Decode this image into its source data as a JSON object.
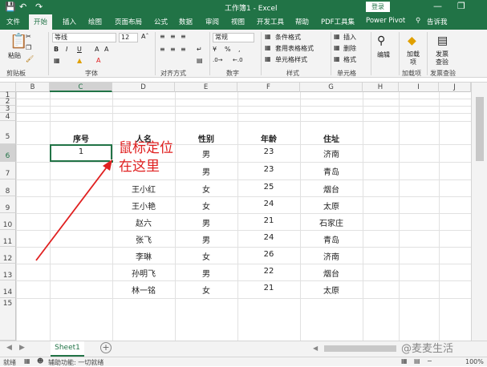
{
  "title_bar": {
    "title": "工作簿1 - Excel",
    "login_label": "登录",
    "minimize_icon": "minimize-icon",
    "restore_icon": "restore-icon"
  },
  "tabs": [
    "文件",
    "开始",
    "插入",
    "绘图",
    "页面布局",
    "公式",
    "数据",
    "审阅",
    "视图",
    "开发工具",
    "帮助",
    "PDF工具集",
    "Power Pivot",
    "告诉我"
  ],
  "active_tab": "开始",
  "ribbon": {
    "paste": "粘贴",
    "font_name": "等线",
    "font_size": "12",
    "number_format": "常规",
    "cond_format": "条件格式",
    "table_format": "套用表格格式",
    "cell_style": "单元格样式",
    "insert": "插入",
    "delete": "删除",
    "format": "格式",
    "edit": "编辑",
    "addin": "加载项",
    "invoice": "发票查验",
    "groups": [
      "剪贴板",
      "字体",
      "对齐方式",
      "数字",
      "样式",
      "单元格",
      "加载项",
      "发票查验"
    ]
  },
  "columns": [
    "B",
    "C",
    "D",
    "E",
    "F",
    "G",
    "H",
    "I",
    "J"
  ],
  "selected_column": "C",
  "rows": [
    "1",
    "2",
    "3",
    "4",
    "5",
    "6",
    "7",
    "8",
    "9",
    "10",
    "11",
    "12",
    "13",
    "14",
    "15"
  ],
  "selected_row": "6",
  "table": {
    "headers": [
      "序号",
      "人名",
      "性别",
      "年龄",
      "住址"
    ],
    "rows": [
      [
        "1",
        "",
        "男",
        "23",
        "济南"
      ],
      [
        "",
        "",
        "男",
        "23",
        "青岛"
      ],
      [
        "",
        "王小红",
        "女",
        "25",
        "烟台"
      ],
      [
        "",
        "王小艳",
        "女",
        "24",
        "太原"
      ],
      [
        "",
        "赵六",
        "男",
        "21",
        "石家庄"
      ],
      [
        "",
        "张飞",
        "男",
        "24",
        "青岛"
      ],
      [
        "",
        "李琳",
        "女",
        "26",
        "济南"
      ],
      [
        "",
        "孙明飞",
        "男",
        "22",
        "烟台"
      ],
      [
        "",
        "林一铭",
        "女",
        "21",
        "太原"
      ]
    ]
  },
  "annotation": {
    "line1": "鼠标定位",
    "line2": "在这里",
    "color": "#e02020"
  },
  "sheet": {
    "tab_label": "Sheet1",
    "add_label": "+"
  },
  "status": {
    "ready": "就绪",
    "accessibility": "辅助功能: 一切就绪",
    "zoom": "100%"
  },
  "watermark": "@麦麦生活",
  "accent": "#217346"
}
